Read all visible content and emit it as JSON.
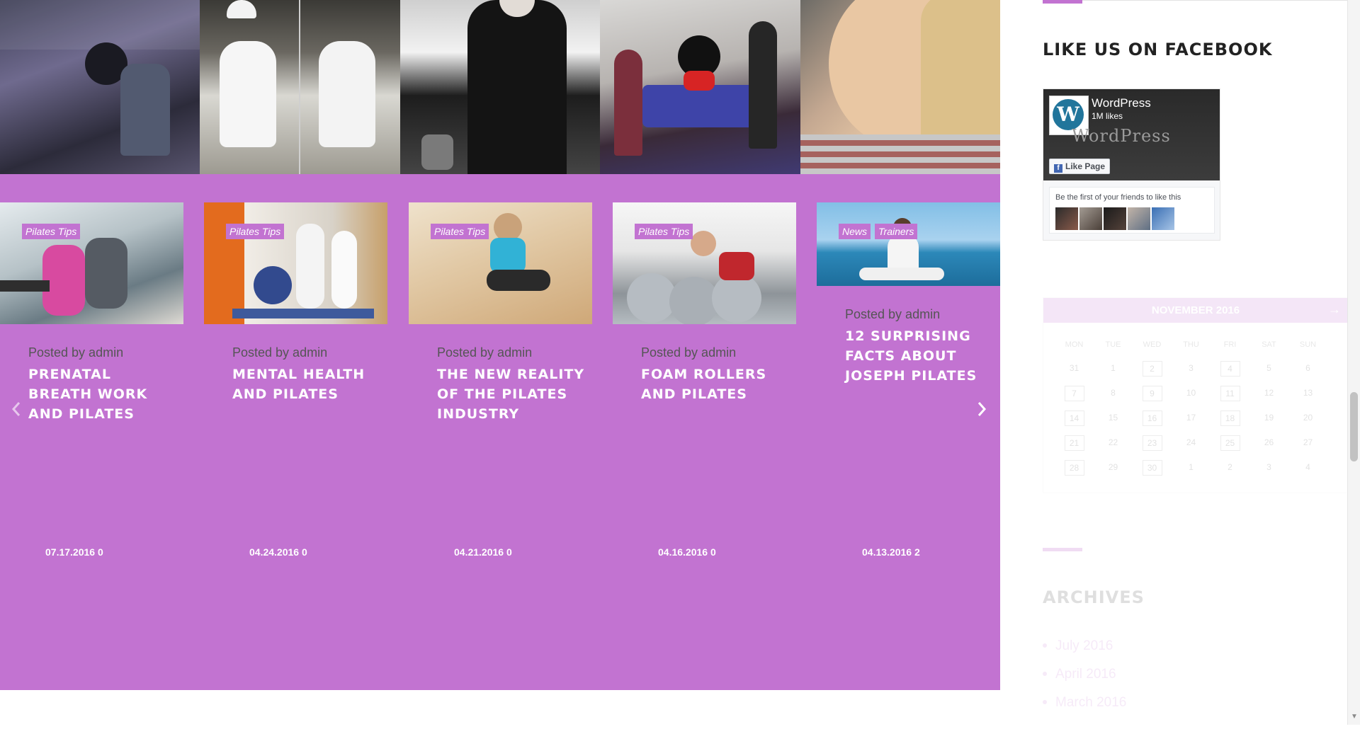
{
  "colors": {
    "accent": "#c273d1",
    "title_text": "#ffffff",
    "meta_text": "#555555",
    "sidebar_heading": "#222222"
  },
  "instagram": {
    "photos": [
      {
        "icon": "gym-photo"
      },
      {
        "icon": "man-exercising-photo"
      },
      {
        "icon": "selfie-photo"
      },
      {
        "icon": "group-mickey-photo"
      },
      {
        "icon": "woman-selfie-photo"
      }
    ]
  },
  "posts": [
    {
      "tags": [
        "Pilates Tips"
      ],
      "meta": "Posted by admin",
      "title": "PRENATAL BREATH WORK AND PILATES",
      "date": "07.17.2016 0"
    },
    {
      "tags": [
        "Pilates Tips"
      ],
      "meta": "Posted by admin",
      "title": "MENTAL HEALTH AND PILATES",
      "date": "04.24.2016 0"
    },
    {
      "tags": [
        "Pilates Tips"
      ],
      "meta": "Posted by admin",
      "title": "THE NEW REALITY OF THE PILATES INDUSTRY",
      "date": "04.21.2016 0"
    },
    {
      "tags": [
        "Pilates Tips"
      ],
      "meta": "Posted by admin",
      "title": "FOAM ROLLERS AND PILATES",
      "date": "04.16.2016 0"
    },
    {
      "tags": [
        "News",
        "Trainers"
      ],
      "meta": "Posted by admin",
      "title": "12 SURPRISING FACTS ABOUT JOSEPH PILATES",
      "date": "04.13.2016 2"
    }
  ],
  "carousel": {
    "prev_icon": "chevron-left-icon",
    "next_icon": "chevron-right-icon"
  },
  "sidebar": {
    "facebook_title": "LIKE US ON FACEBOOK",
    "facebook": {
      "page_name": "WordPress",
      "likes": "1M likes",
      "wordmark": "WordPress",
      "like_button": "Like Page",
      "friends_text": "Be the first of your friends to like this"
    },
    "calendar": {
      "month": "NOVEMBER 2016",
      "next_label": "→",
      "day_headers": [
        "MON",
        "TUE",
        "WED",
        "THU",
        "FRI",
        "SAT",
        "SUN"
      ],
      "rows": [
        [
          "31",
          "1",
          "2",
          "3",
          "4",
          "5",
          "6"
        ],
        [
          "7",
          "8",
          "9",
          "10",
          "11",
          "12",
          "13"
        ],
        [
          "14",
          "15",
          "16",
          "17",
          "18",
          "19",
          "20"
        ],
        [
          "21",
          "22",
          "23",
          "24",
          "25",
          "26",
          "27"
        ],
        [
          "28",
          "29",
          "30",
          "1",
          "2",
          "3",
          "4"
        ]
      ]
    },
    "archives_title": "ARCHIVES",
    "archives": [
      "July 2016",
      "April 2016",
      "March 2016"
    ]
  }
}
